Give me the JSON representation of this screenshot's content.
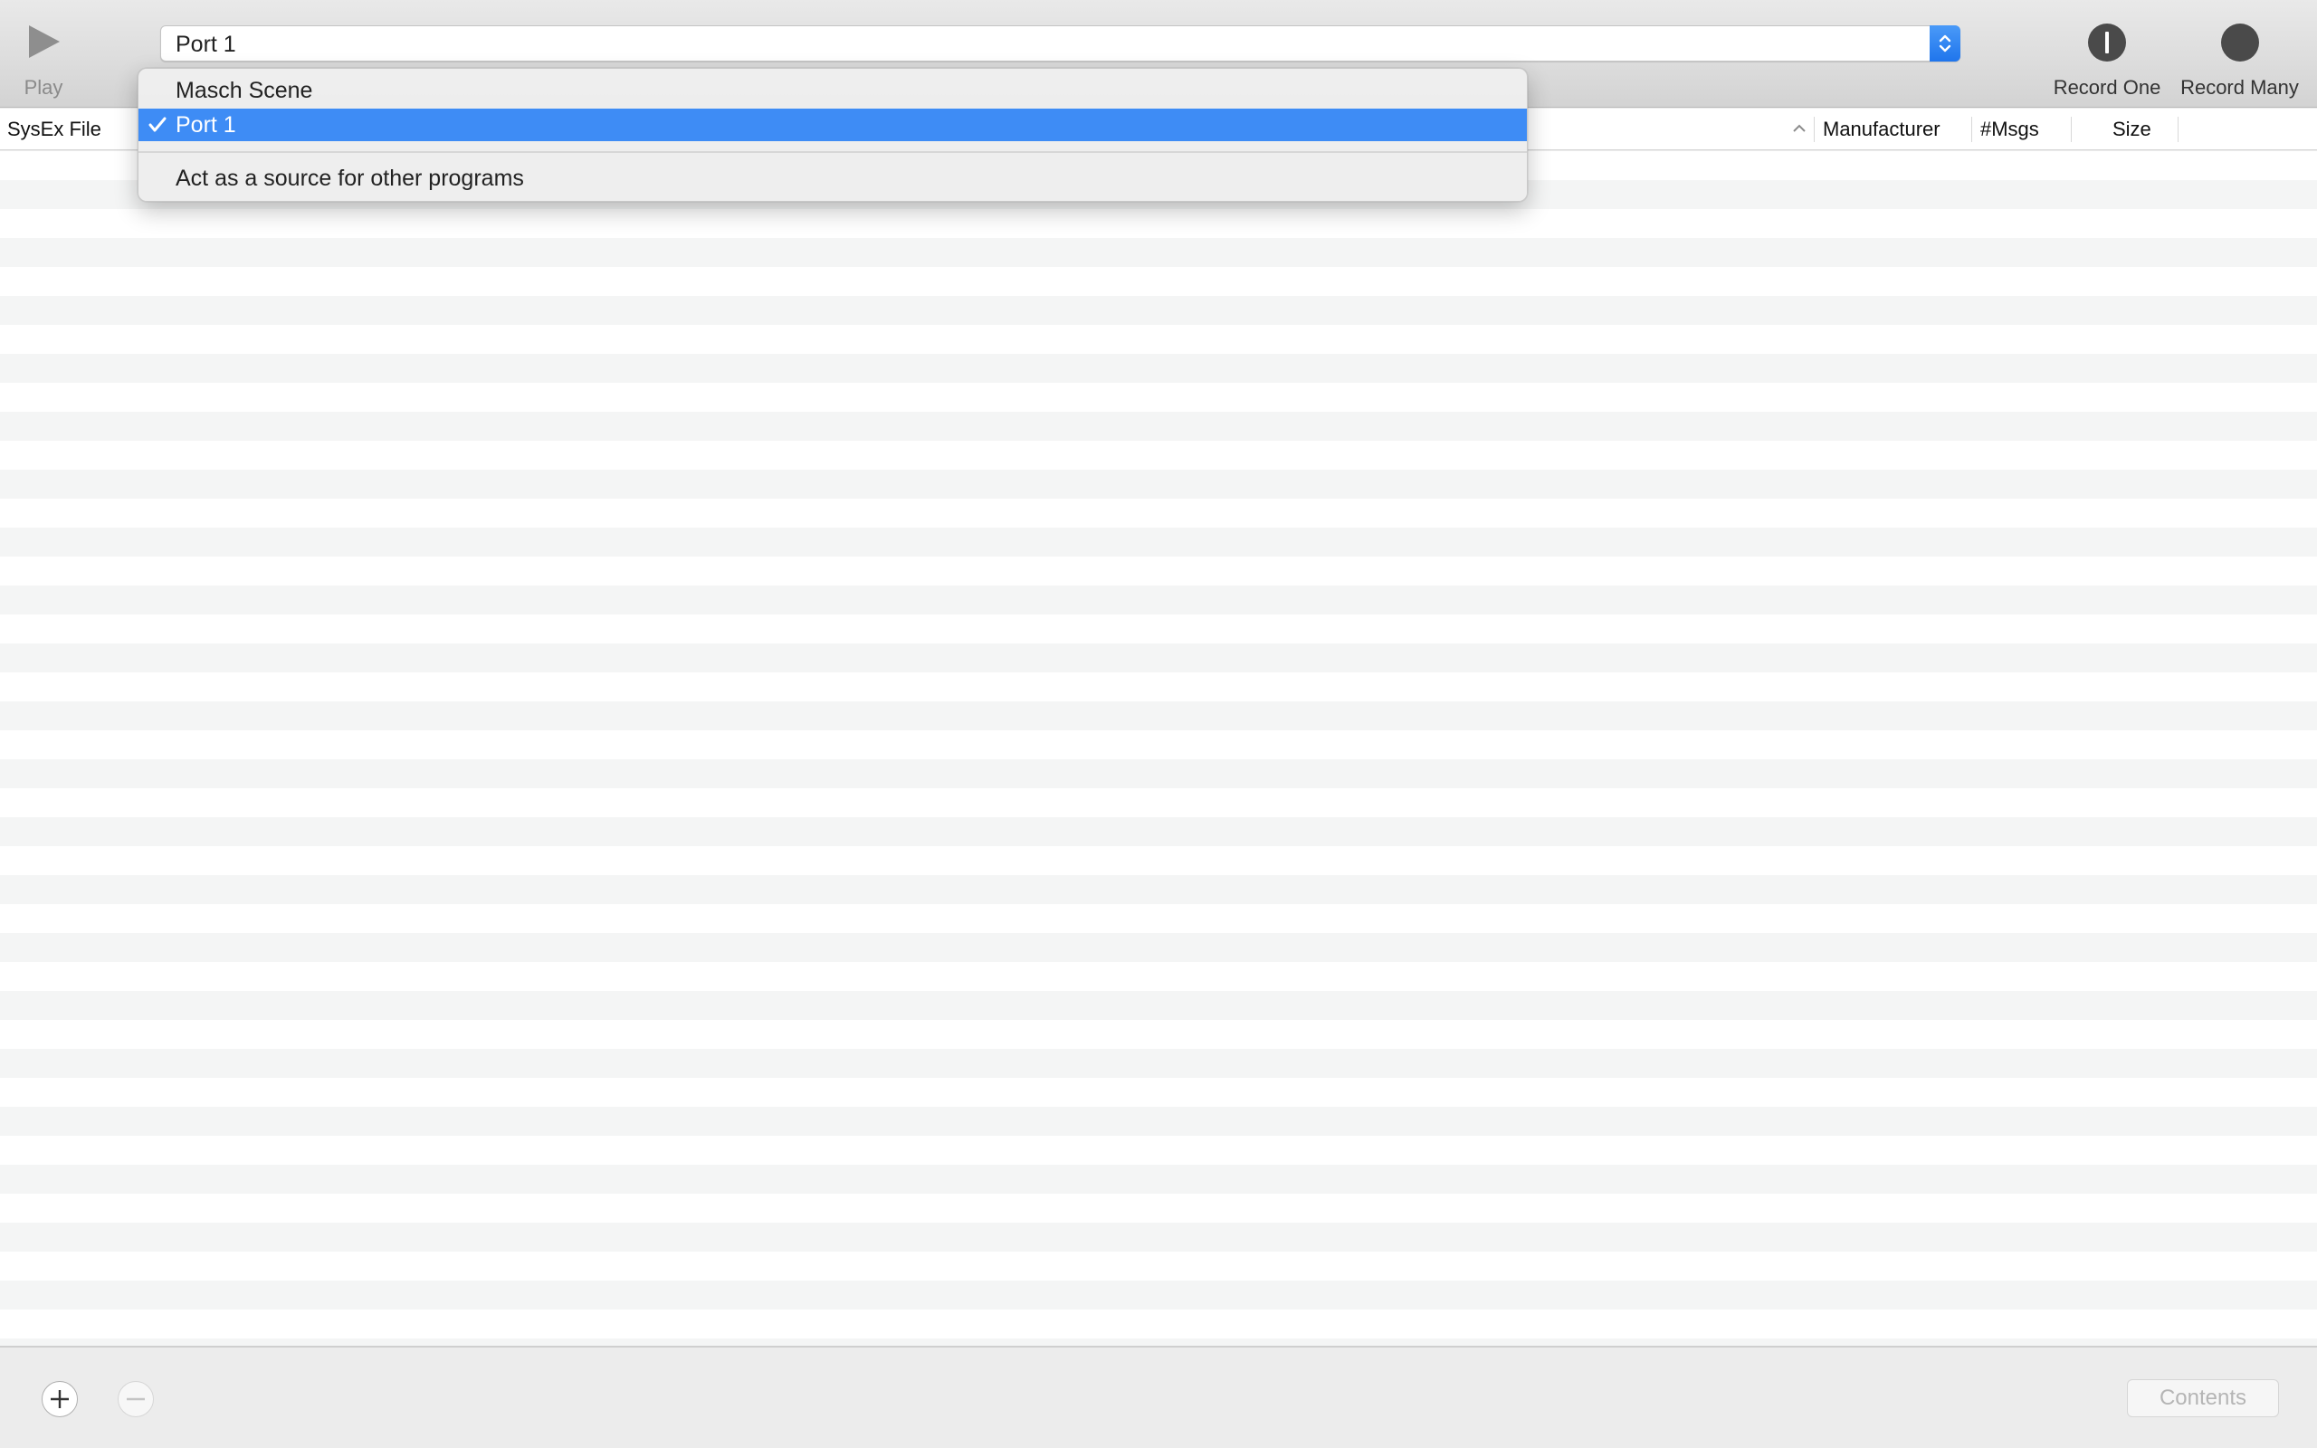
{
  "toolbar": {
    "play_label": "Play",
    "record_one_label": "Record One",
    "record_many_label": "Record Many",
    "port_selected": "Port 1"
  },
  "port_menu": {
    "items": [
      {
        "label": "Masch Scene",
        "checked": false
      },
      {
        "label": "Port 1",
        "checked": true
      }
    ],
    "extra_item": "Act as a source for other programs"
  },
  "table": {
    "columns": [
      "SysEx File",
      "Manufacturer",
      "#Msgs",
      "Size"
    ],
    "rows": []
  },
  "bottom_bar": {
    "contents_label": "Contents"
  },
  "colors": {
    "accent": "#3e8cf5",
    "row_stripe": "#f4f5f5"
  }
}
